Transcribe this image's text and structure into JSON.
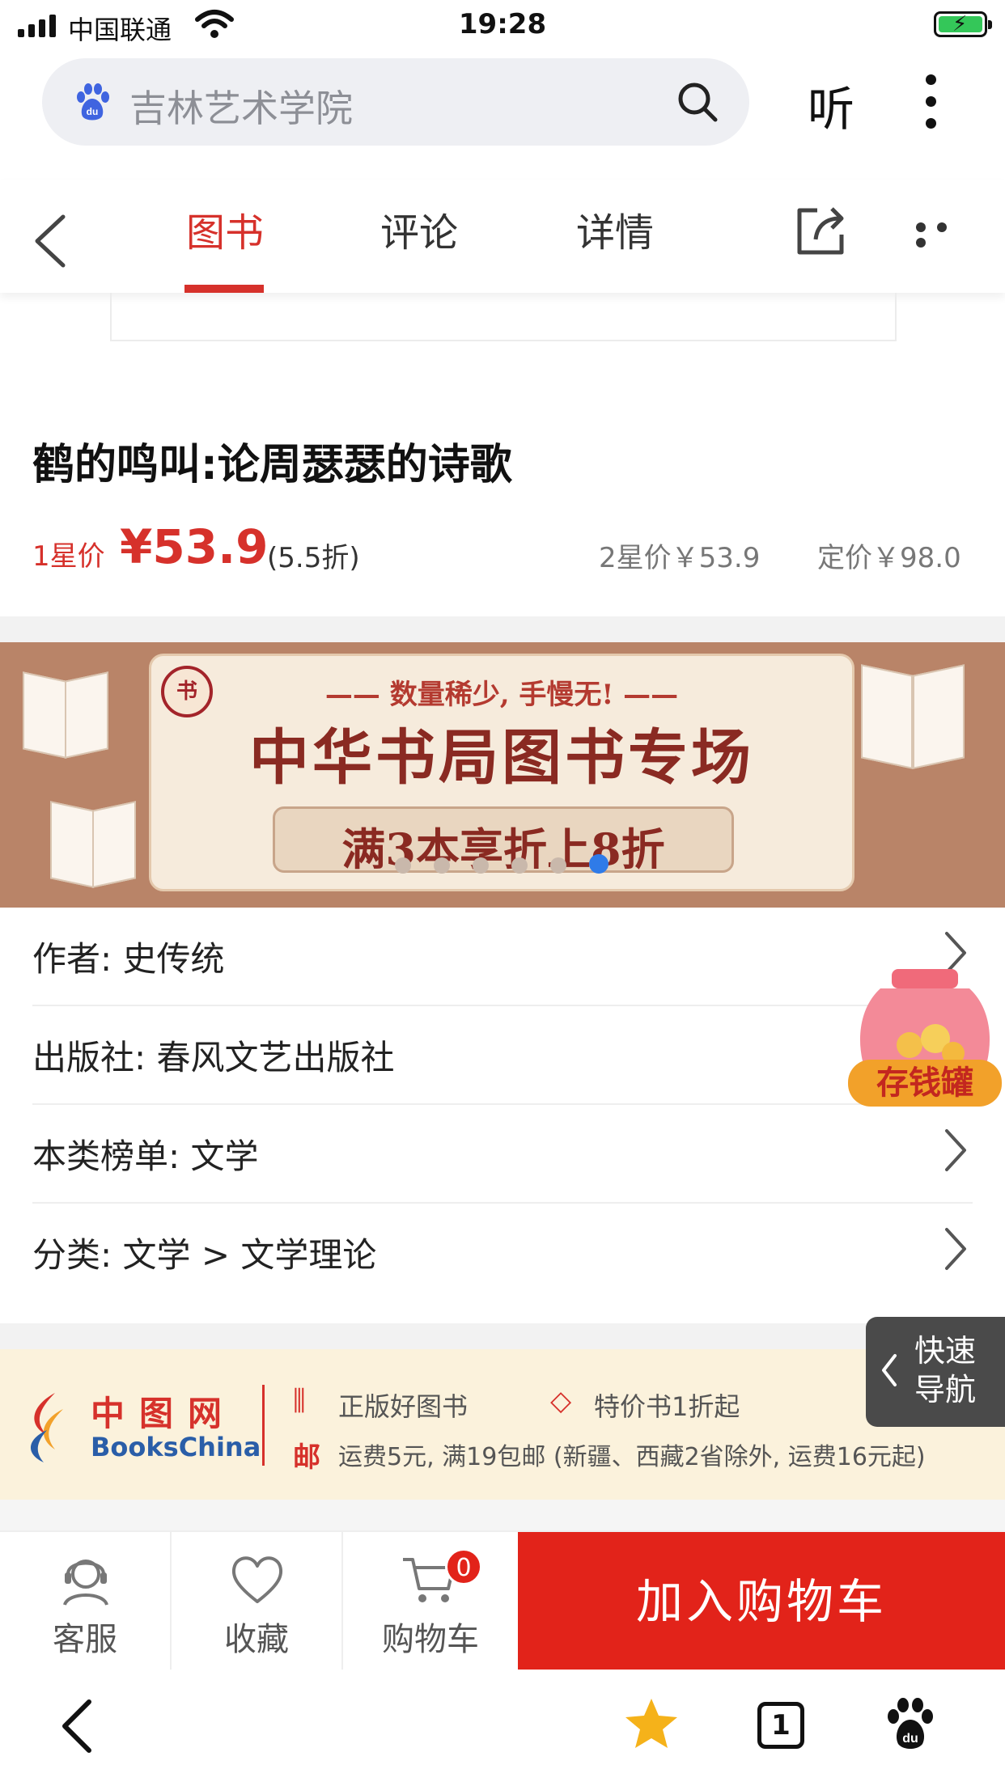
{
  "status_bar": {
    "carrier": "中国联通",
    "time": "19:28"
  },
  "search": {
    "query": "吉林艺术学院",
    "listen_label": "听"
  },
  "tabs": [
    {
      "label": "图书",
      "active": true
    },
    {
      "label": "评论",
      "active": false
    },
    {
      "label": "详情",
      "active": false
    }
  ],
  "book": {
    "title": "鹤的鸣叫:论周瑟瑟的诗歌",
    "star1_label": "1星价",
    "star1_price": "¥53.9",
    "discount": "(5.5折)",
    "star2_price": "2星价￥53.9",
    "list_price": "定价￥98.0"
  },
  "banner": {
    "seal": "书",
    "tagline": "—— 数量稀少, 手慢无! ——",
    "headline": "中华书局图书专场",
    "offer": "满3本享折上8折",
    "slide_count": 6,
    "active_slide": 6
  },
  "info_rows": [
    {
      "text": "作者:  史传统"
    },
    {
      "text": "出版社:  春风文艺出版社"
    },
    {
      "text": "本类榜单:  文学"
    },
    {
      "text": "分类:  文学 > 文学理论"
    }
  ],
  "savings_jar": {
    "label": "存钱罐"
  },
  "store": {
    "name_cn": "中图网",
    "name_en": "BooksChina",
    "feature1": "正版好图书",
    "feature2": "特价书1折起",
    "shipping_icon": "邮",
    "shipping": "运费5元, 满19包邮 (新疆、西藏2省除外, 运费16元起)"
  },
  "quick_nav": {
    "label": "快速导航"
  },
  "action_bar": {
    "service": "客服",
    "favorite": "收藏",
    "cart": "购物车",
    "cart_count": "0",
    "add_to_cart": "加入购物车"
  },
  "browser_bar": {
    "tab_count": "1"
  },
  "colors": {
    "accent": "#d6312b",
    "cart_button": "#e2231a",
    "link_blue": "#2f7be8"
  }
}
